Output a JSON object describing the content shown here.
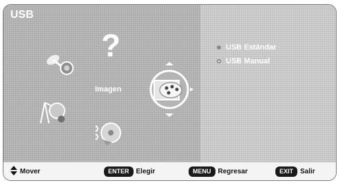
{
  "menu": {
    "title": "USB",
    "center_label": "Imagen",
    "question_mark": "?",
    "icons": [
      "satellite-icon",
      "question-icon",
      "clock-icon",
      "image-settings-icon",
      "antenna-icon",
      "disc-icon"
    ],
    "options": [
      {
        "label": "USB Estándar",
        "state": "filled"
      },
      {
        "label": "USB Manual",
        "state": "hollow"
      }
    ]
  },
  "footer": {
    "move_label": "Mover",
    "enter_key": "ENTER",
    "enter_label": "Elegir",
    "menu_key": "MENU",
    "menu_label": "Regresar",
    "exit_key": "EXIT",
    "exit_label": "Salir"
  },
  "colors": {
    "main_bg": "#a9a9a9",
    "right_bg": "#bfbfbf",
    "footer_bg": "#f4f4f4",
    "key_bg": "#1a1a1a",
    "text_light": "#ffffff"
  }
}
